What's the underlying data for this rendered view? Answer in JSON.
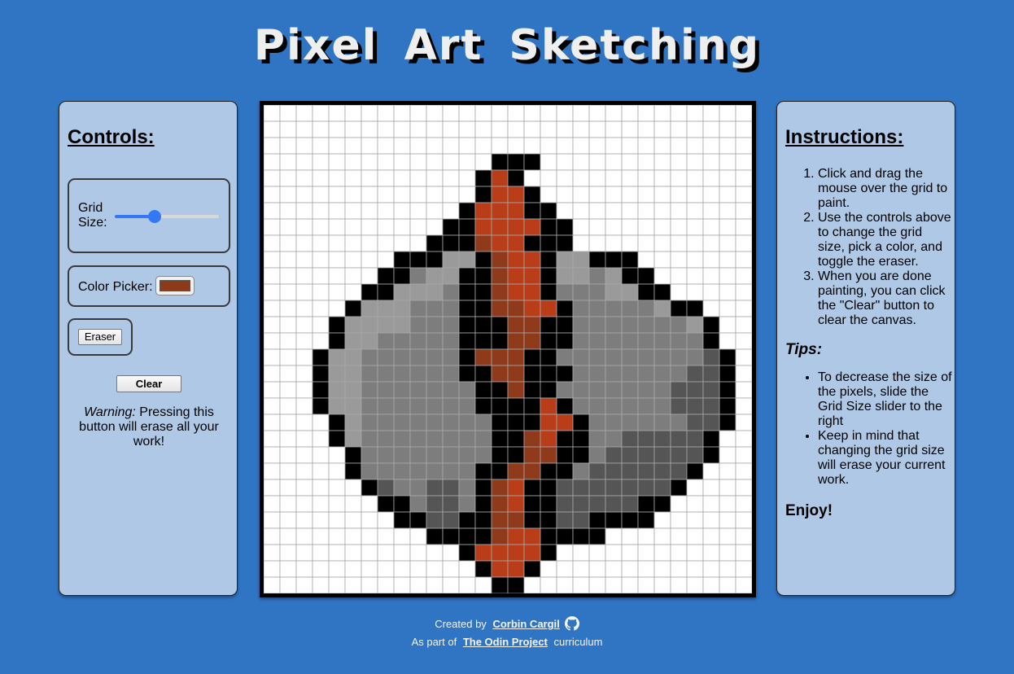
{
  "title": "Pixel Art Sketching",
  "controls": {
    "heading": "Controls:",
    "grid_size_label": "Grid Size:",
    "grid_size_value": 0.38,
    "color_picker_label": "Color Picker:",
    "selected_color": "#8b3a1a",
    "eraser_label": "Eraser",
    "clear_label": "Clear",
    "warning_prefix": "Warning:",
    "warning_text": " Pressing this button will erase all your work!"
  },
  "canvas": {
    "grid_size": 30,
    "palette": {
      "K": "#000000",
      "R": "#b83d18",
      "r": "#8e3a1b",
      "L": "#9a9a9a",
      "M": "#7d7d7d",
      "D": "#555555"
    },
    "rows": [
      "..............................",
      "..............................",
      "..............................",
      "..............KKK.............",
      ".............KRK..............",
      ".............KRRK.............",
      "............KRRRKK............",
      "...........KKRRRRKK...........",
      "..........KKKrRRKKK...........",
      "........KKKLLKrRRKLLKKK.......",
      ".......KKMLLKKrRRKLLMLKK......",
      "......KKLLLMKKrRRKMMMLLKK.....",
      ".....KLLLMMMKKrrRRKMMMMMLKK....",
      "....KLLLLMMMKKKrrKKMMMMMMMLK...",
      "....KLLMMMMMKKKrrKKMMMMMMMMK...",
      "...KLLMMMMMMKrrrKKMMMMMMMMMDK..",
      "...KLLMMMMMMKKrrKKKMMMMMMMDDK..",
      "...KLLMMMMMMMKKrKKMMMMMMMDDDK..",
      "...KLLMMMMMMMKKKKRKMMMMMMDDDK..",
      "....KLMMMMMMMMKKKRRKMMMMMMDDK..",
      "....KLMMMMMMMMKKrRKKMMDDDDDK...",
      ".....KMMMMMMMMKKrrKKMDDDDDDK...",
      ".....KMMMMMMMKKrrKKMDDDDDDK....",
      "......KDMMDDMKrRKKDDDDDDDK.....",
      ".......KKMDDMKrRKKDDDDDKK......",
      "........KKDDKKrrKKDDKKKK.......",
      "..........KKKKrRRKKKK..........",
      "............KRRRRK............",
      ".............KRRK.............",
      "..............KK.............."
    ]
  },
  "instructions": {
    "heading": "Instructions:",
    "steps": [
      "Click and drag the mouse over the grid to paint.",
      "Use the controls above to change the grid size, pick a color, and toggle the eraser.",
      "When you are done painting, you can click the \"Clear\" button to clear the canvas."
    ],
    "tips_heading": "Tips:",
    "tips": [
      "To decrease the size of the pixels, slide the Grid Size slider to the right",
      "Keep in mind that changing the grid size will erase your current work."
    ],
    "enjoy": "Enjoy!"
  },
  "footer": {
    "created_by": "Created by",
    "author": "Corbin Cargil",
    "github_icon": "github-icon",
    "as_part_of": "As part of",
    "project": "The Odin Project",
    "curriculum": "curriculum"
  }
}
